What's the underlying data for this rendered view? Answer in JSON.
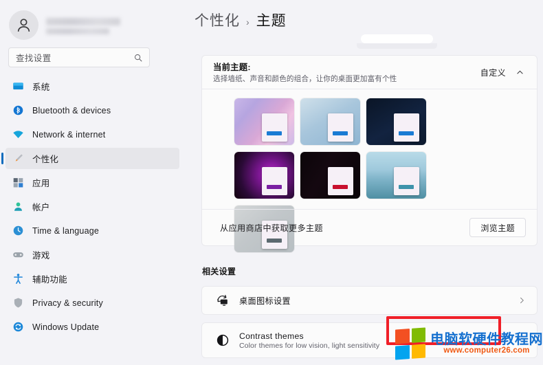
{
  "profile": {
    "avatar_icon": "person-avatar-icon",
    "name_redacted": true
  },
  "search": {
    "placeholder": "查找设置",
    "value": "",
    "icon": "search-icon"
  },
  "sidebar": {
    "items": [
      {
        "label": "系统",
        "icon": "system-monitor-icon",
        "selected": false
      },
      {
        "label": "Bluetooth & devices",
        "icon": "bluetooth-icon",
        "selected": false
      },
      {
        "label": "Network & internet",
        "icon": "wifi-icon",
        "selected": false
      },
      {
        "label": "个性化",
        "icon": "paintbrush-icon",
        "selected": true
      },
      {
        "label": "应用",
        "icon": "apps-icon",
        "selected": false
      },
      {
        "label": "帐户",
        "icon": "account-person-icon",
        "selected": false
      },
      {
        "label": "Time & language",
        "icon": "clock-icon",
        "selected": false
      },
      {
        "label": "游戏",
        "icon": "gamepad-icon",
        "selected": false
      },
      {
        "label": "辅助功能",
        "icon": "accessibility-person-icon",
        "selected": false
      },
      {
        "label": "Privacy & security",
        "icon": "shield-icon",
        "selected": false
      },
      {
        "label": "Windows Update",
        "icon": "update-refresh-icon",
        "selected": false
      }
    ]
  },
  "breadcrumb": {
    "parent": "个性化",
    "separator": "›",
    "current": "主题"
  },
  "theme_card": {
    "title": "当前主题:",
    "subtitle": "选择墙纸、声音和颜色的组合，让你的桌面更加富有个性",
    "customize_label": "自定义",
    "collapse_icon": "chevron-up-icon",
    "themes": [
      {
        "name": "theme-purple-glow",
        "accent": "#1a7bd4",
        "bg": "linear-gradient(130deg,#c9b7e8 0%,#b6a5e0 25%,#d9a8d6 55%,#f0c3e2 72%,#cdbbe8 100%)"
      },
      {
        "name": "theme-windows-bloom-light",
        "accent": "#1a7bd4",
        "bg": "linear-gradient(150deg,#cfe0ea 0%,#a8c6dc 45%,#8fb5d2 100%)"
      },
      {
        "name": "theme-windows-bloom-dark",
        "accent": "#1a7bd4",
        "bg": "linear-gradient(150deg,#0a1526 0%,#122340 55%,#0c1a2e 100%)"
      },
      {
        "name": "theme-purple-eclipse",
        "accent": "#7a1fa2",
        "bg": "radial-gradient(circle at 62% 48%, #c02ad0 0%, #7a1690 30%, #2a0a36 70%, #14030f 100%)"
      },
      {
        "name": "theme-dark-flora",
        "accent": "#c8102e",
        "bg": "linear-gradient(120deg,#0b0509 0%,#140810 40%,#0a0408 100%)"
      },
      {
        "name": "theme-lake-sunset",
        "accent": "#3e93ab",
        "bg": "linear-gradient(180deg,#b9dbe8 0%,#9fc9dc 38%,#7fb4c9 58%,#4f8fa3 100%)"
      },
      {
        "name": "theme-light-bloom-gray",
        "accent": "#5c6970",
        "bg": "linear-gradient(140deg,#d3d6d7 0%,#c2c7ca 45%,#b7bec2 100%)"
      }
    ],
    "store_label": "从应用商店中获取更多主题",
    "browse_button": "浏览主题"
  },
  "related_settings": {
    "heading": "相关设置",
    "rows": [
      {
        "title": "桌面图标设置",
        "subtitle": "",
        "icon": "desktop-icon-settings-icon",
        "chevron": "chevron-right-icon",
        "highlighted": true
      },
      {
        "title": "Contrast themes",
        "subtitle": "Color themes for low vision, light sensitivity",
        "icon": "contrast-circle-icon",
        "chevron": "",
        "highlighted": false
      }
    ]
  },
  "annotation": {
    "box_color": "#f01f28"
  },
  "watermark": {
    "cn_text": "电脑软硬件教程网",
    "url": "www.computer26.com",
    "cn_color": "#1570cf",
    "url_color": "#f05a14",
    "logo_colors": [
      "#f35022",
      "#80bb03",
      "#03a4ef",
      "#ffb902"
    ]
  }
}
